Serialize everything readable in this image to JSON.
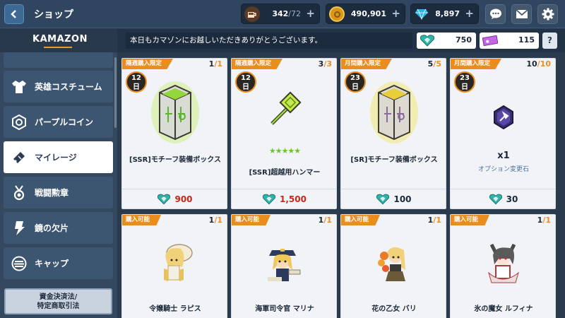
{
  "header": {
    "title": "ショップ",
    "currencies": [
      {
        "icon": "coffee-icon",
        "value": "342",
        "max": "/72"
      },
      {
        "icon": "gold-coin-icon",
        "value": "490,901",
        "max": ""
      },
      {
        "icon": "diamond-icon",
        "value": "8,897",
        "max": ""
      }
    ],
    "buttons": [
      "chat-icon",
      "mail-icon",
      "gear-icon"
    ]
  },
  "sidebar": {
    "logo": "KAMAZON",
    "items": [
      {
        "label": "英雄コスチューム",
        "icon": "costume-icon"
      },
      {
        "label": "パープルコイン",
        "icon": "purple-coin-icon"
      },
      {
        "label": "マイレージ",
        "icon": "ticket-icon",
        "active": true
      },
      {
        "label": "戦闘勲章",
        "icon": "medal-icon"
      },
      {
        "label": "鏡の欠片",
        "icon": "mirror-shard-icon"
      },
      {
        "label": "キャップ",
        "icon": "cap-icon"
      }
    ],
    "legal_line1": "資金決済法/",
    "legal_line2": "特定商取引法"
  },
  "info": {
    "message": "本日もカマゾンにお越しいただきありがとうございます。",
    "mileage": "750",
    "tickets": "115",
    "help": "?"
  },
  "cards": [
    {
      "tag": "隔週購入限定",
      "count": "1",
      "limit": "/1",
      "badge_num": "12",
      "badge_unit": "日",
      "name": "[SSR]モチーフ装備ボックス",
      "price": "900",
      "price_color": "red"
    },
    {
      "tag": "隔週購入限定",
      "count": "3",
      "limit": "/3",
      "badge_num": "12",
      "badge_unit": "日",
      "name": "[SSR]超越用ハンマー",
      "stars": "★★★★★",
      "price": "1,500",
      "price_color": "red"
    },
    {
      "tag": "月間購入限定",
      "count": "5",
      "limit": "/5",
      "badge_num": "23",
      "badge_unit": "日",
      "name": "[SR]モチーフ装備ボックス",
      "price": "100",
      "price_color": "black"
    },
    {
      "tag": "月間購入限定",
      "count": "10",
      "limit": "/10",
      "badge_num": "23",
      "badge_unit": "日",
      "qty": "x1",
      "sub": "オプション変更石",
      "price": "30",
      "price_color": "black"
    },
    {
      "tag": "購入可能",
      "count": "1",
      "limit": "/1",
      "name": "令嬢騎士 ラピス"
    },
    {
      "tag": "購入可能",
      "count": "1",
      "limit": "/1",
      "name": "海軍司令官 マリナ"
    },
    {
      "tag": "購入可能",
      "count": "1",
      "limit": "/1",
      "name": "花の乙女 バリ"
    },
    {
      "tag": "購入可能",
      "count": "1",
      "limit": "/1",
      "name": "氷の魔女 ルフィナ"
    }
  ],
  "colors": {
    "accent": "#e98d1f",
    "price_red": "#c8261b",
    "panel": "#2b3b4e"
  }
}
